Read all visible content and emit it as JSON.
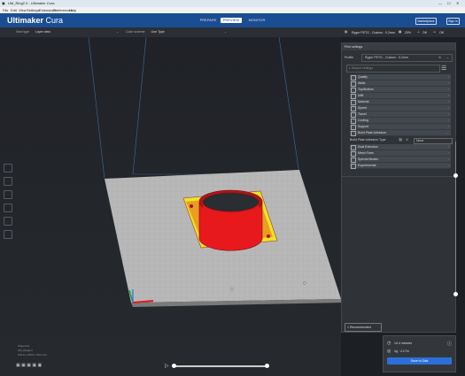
{
  "window": {
    "title": "UM_Ring2.3 - Ultimaker Cura",
    "menu": [
      "File",
      "Edit",
      "View",
      "Settings",
      "Extensions",
      "Preferences",
      "Help"
    ]
  },
  "header": {
    "logo_main": "Ultimaker",
    "logo_sub": "Cura",
    "stages": [
      {
        "label": "PREPARE",
        "active": false
      },
      {
        "label": "PREVIEW",
        "active": true
      },
      {
        "label": "MONITOR",
        "active": false
      }
    ],
    "marketplace": "Marketplace",
    "signin": "Sign in"
  },
  "view_toolbar": {
    "view_type_label": "View type",
    "view_type_value": "Layer view",
    "color_scheme_label": "Color scheme",
    "color_scheme_value": "Line Type"
  },
  "print_setup_bar": {
    "printer": "Ryger PETG - Custom - 0.2mm",
    "infill": "20%",
    "support": "Off",
    "adhesion": "Off"
  },
  "panel": {
    "title": "Print settings",
    "profile_label": "Profile",
    "profile_value": "Ryger PETG - Custom - 0.2mm",
    "search_placeholder": "Search settings",
    "categories": [
      {
        "name": "Quality",
        "icon": "quality-icon"
      },
      {
        "name": "Walls",
        "icon": "walls-icon"
      },
      {
        "name": "Top/Bottom",
        "icon": "topbottom-icon"
      },
      {
        "name": "Infill",
        "icon": "infill-icon"
      },
      {
        "name": "Material",
        "icon": "material-icon"
      },
      {
        "name": "Speed",
        "icon": "speed-icon"
      },
      {
        "name": "Travel",
        "icon": "travel-icon"
      },
      {
        "name": "Cooling",
        "icon": "cooling-icon"
      },
      {
        "name": "Support",
        "icon": "support-icon"
      },
      {
        "name": "Build Plate Adhesion",
        "icon": "adhesion-icon"
      }
    ],
    "adhesion_type_label": "Build Plate Adhesion Type",
    "adhesion_type_value": "None",
    "categories2": [
      {
        "name": "Dual Extrusion",
        "icon": "dual-icon"
      },
      {
        "name": "Mesh Fixes",
        "icon": "mesh-icon"
      },
      {
        "name": "Special Modes",
        "icon": "special-icon"
      },
      {
        "name": "Experimental",
        "icon": "experimental-icon"
      }
    ],
    "recommended_btn": "< Recommended"
  },
  "slice": {
    "time": "1d 4 minutes",
    "material": "4g · 4.17m",
    "save_btn": "Save to Disk"
  },
  "object_list": {
    "header": "Object list",
    "name": "UM_Ring2.3",
    "dims": "100.0 x 100.0 x 30.0 mm"
  },
  "colors": {
    "header_blue": "#1b4d93",
    "accent_blue": "#2c6fd8",
    "model_red": "#e8191c",
    "model_yellow": "#ece424",
    "plate_gray": "#b8b8b8"
  }
}
